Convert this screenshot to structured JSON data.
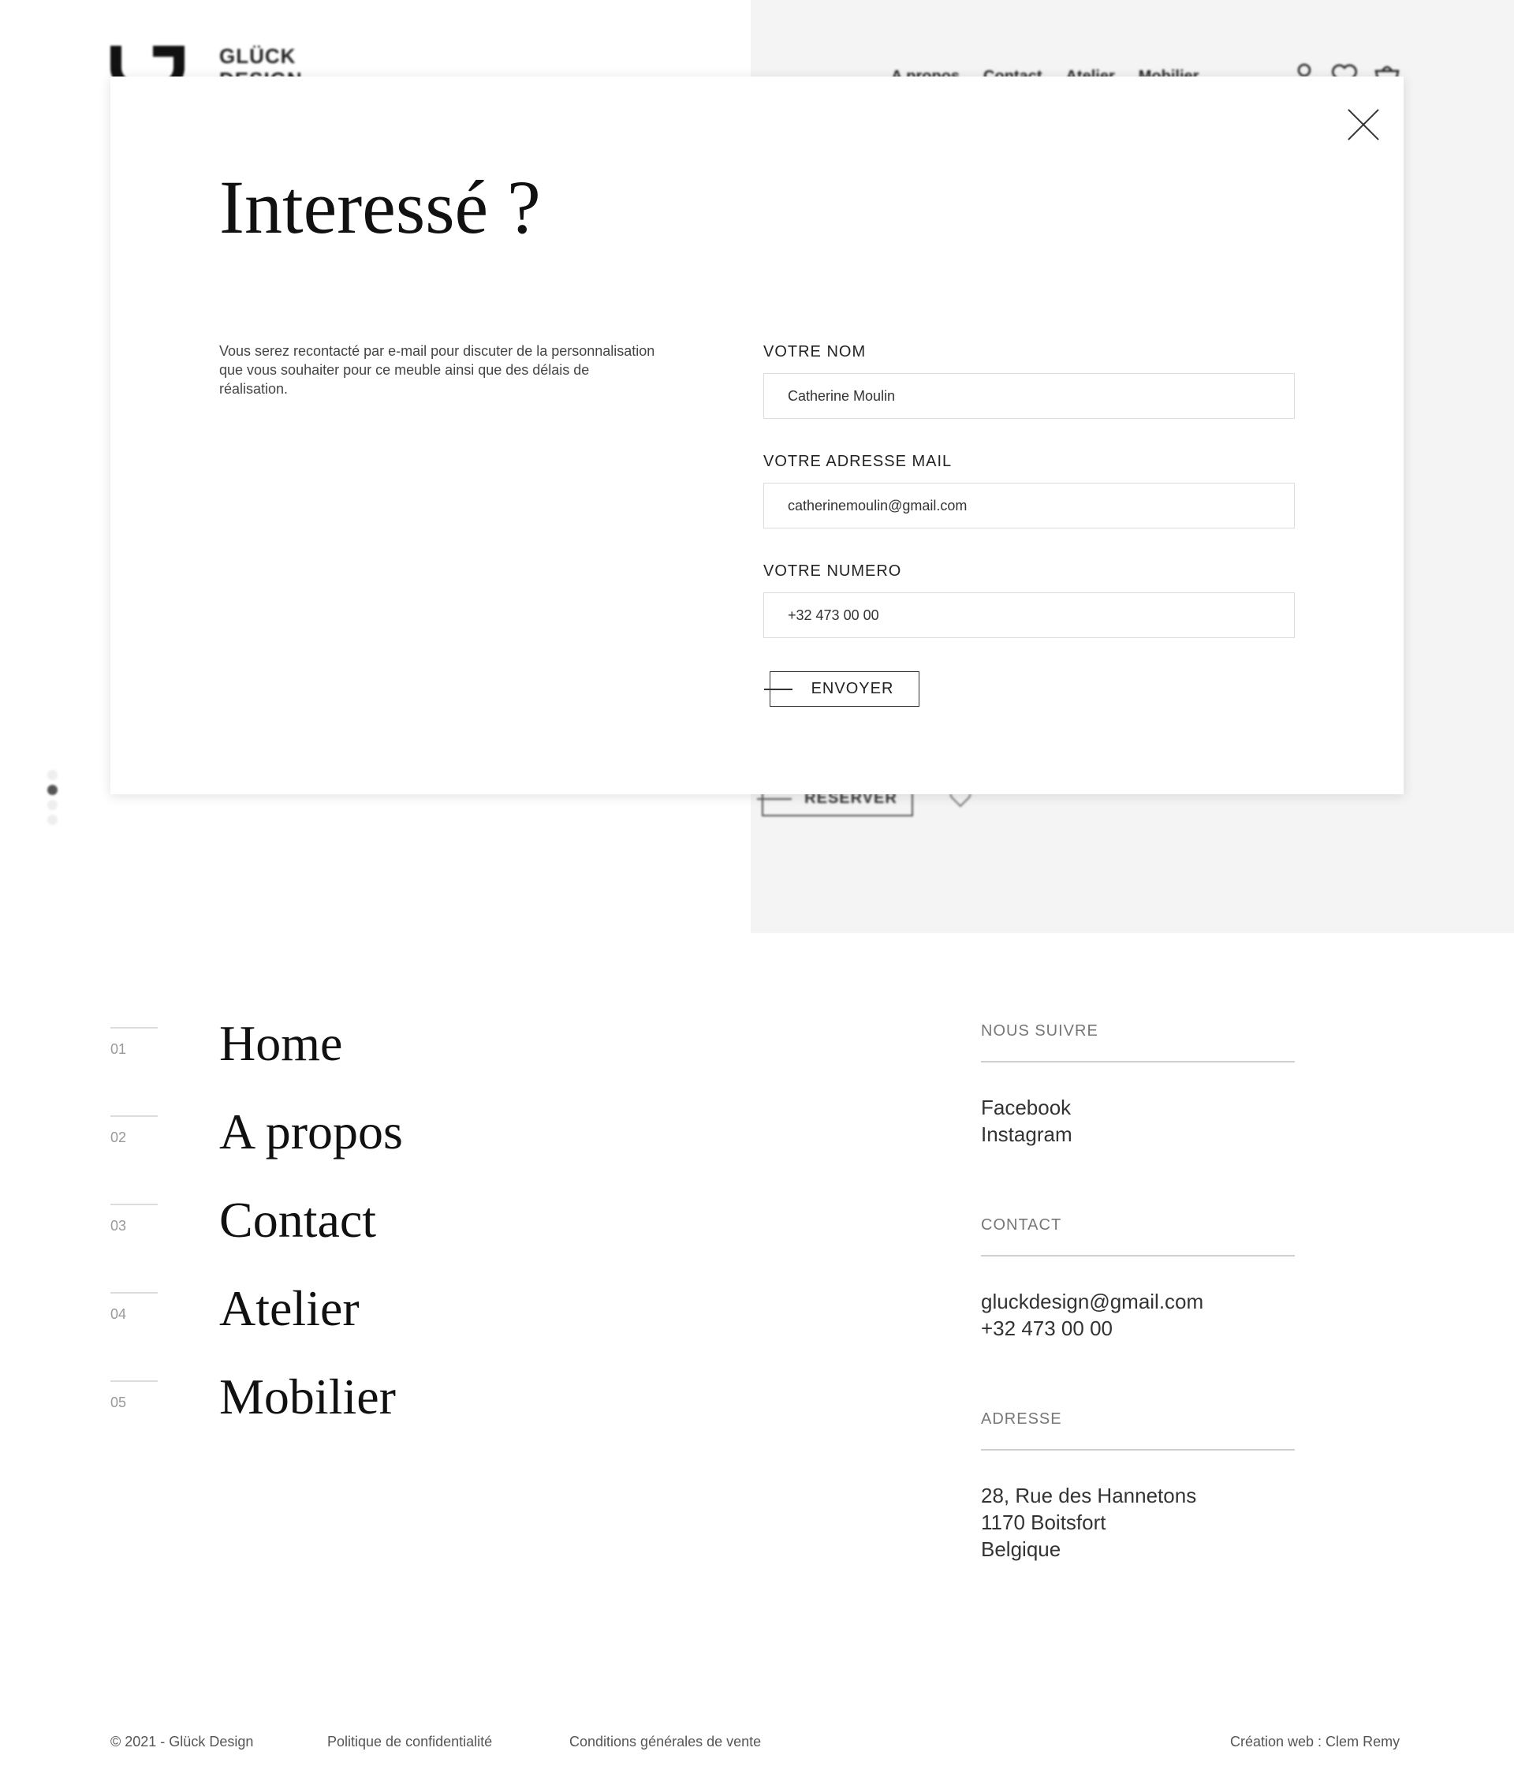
{
  "header": {
    "brand_line1": "GLÜCK",
    "brand_line2": "DESIGN",
    "nav": [
      "A propos",
      "Contact",
      "Atelier",
      "Mobilier"
    ],
    "icons": [
      "user-icon",
      "heart-icon",
      "cart-icon"
    ]
  },
  "slider": {
    "dot_count": 4,
    "active_index": 1
  },
  "product": {
    "reserve_label": "RESERVER"
  },
  "modal": {
    "title": "Interessé ?",
    "description": "Vous serez recontacté par e-mail pour discuter de la personnalisation que vous souhaiter pour ce meuble ainsi que des délais de réalisation.",
    "fields": {
      "name_label": "VOTRE NOM",
      "name_value": "Catherine Moulin",
      "email_label": "VOTRE ADRESSE MAIL",
      "email_value": "catherinemoulin@gmail.com",
      "phone_label": "VOTRE NUMERO",
      "phone_value": "+32 473 00 00"
    },
    "submit_label": "ENVOYER"
  },
  "footer_nav": [
    {
      "num": "01",
      "label": "Home"
    },
    {
      "num": "02",
      "label": "A propos"
    },
    {
      "num": "03",
      "label": "Contact"
    },
    {
      "num": "04",
      "label": "Atelier"
    },
    {
      "num": "05",
      "label": "Mobilier"
    }
  ],
  "footer_info": {
    "follow_title": "NOUS SUIVRE",
    "facebook": "Facebook",
    "instagram": "Instagram",
    "contact_title": "CONTACT",
    "email": "gluckdesign@gmail.com",
    "phone": "+32 473 00 00",
    "address_title": "ADRESSE",
    "address_line1": "28, Rue des Hannetons",
    "address_line2": "1170 Boitsfort",
    "address_line3": "Belgique"
  },
  "legal": {
    "copyright": "© 2021 - Glück Design",
    "privacy": "Politique de confidentialité",
    "terms": "Conditions générales de vente",
    "credit": "Création web : Clem Remy"
  }
}
